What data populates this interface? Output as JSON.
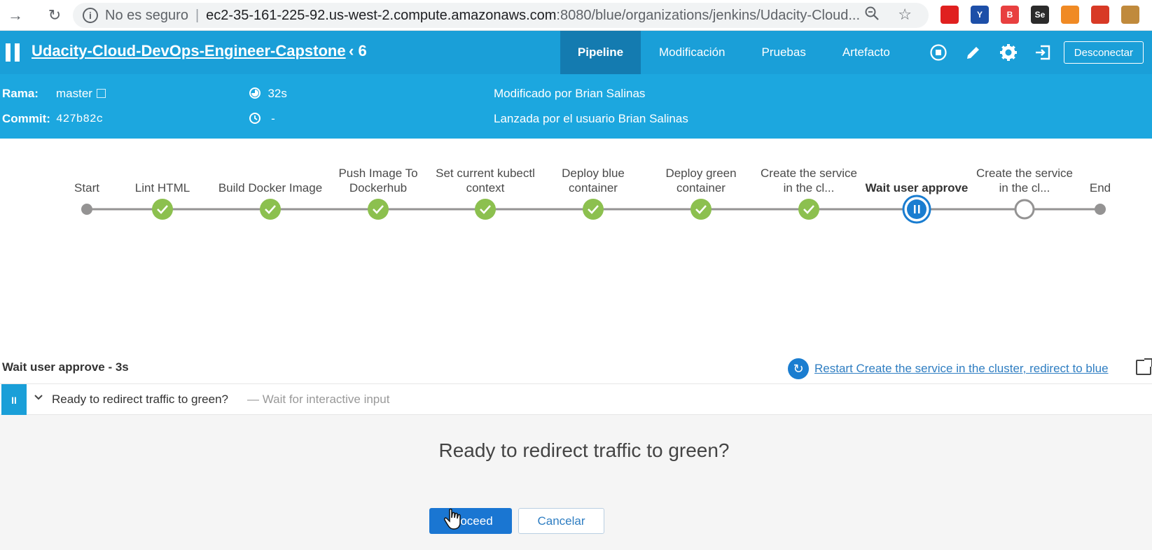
{
  "browser": {
    "security_label": "No es seguro",
    "url_host": "ec2-35-161-225-92.us-west-2.compute.amazonaws.com",
    "url_path": ":8080/blue/organizations/jenkins/Udacity-Cloud...",
    "extensions": [
      {
        "name": "ublock-icon",
        "label": "",
        "color": "#e0201f"
      },
      {
        "name": "vpn-icon",
        "label": "Y",
        "color": "#1d4fa8"
      },
      {
        "name": "extension-b-icon",
        "label": "B",
        "color": "#e84040"
      },
      {
        "name": "selenium-icon",
        "label": "Se",
        "color": "#2b2b2b"
      },
      {
        "name": "extension-figure-icon",
        "label": "",
        "color": "#f08a24"
      },
      {
        "name": "pdf-icon",
        "label": "",
        "color": "#d83a26"
      },
      {
        "name": "cookie-icon",
        "label": "",
        "color": "#c08a3c"
      }
    ]
  },
  "header": {
    "job_title": "Udacity-Cloud-DevOps-Engineer-Capstone",
    "run_number": "6",
    "tabs": [
      {
        "label": "Pipeline",
        "active": true
      },
      {
        "label": "Modificación",
        "active": false
      },
      {
        "label": "Pruebas",
        "active": false
      },
      {
        "label": "Artefacto",
        "active": false
      }
    ],
    "logout_label": "Desconectar"
  },
  "run": {
    "branch_label": "Rama:",
    "branch_value": "master",
    "commit_label": "Commit:",
    "commit_value": "427b82c",
    "duration": "32s",
    "started": "-",
    "changes": "Modificado por Brian Salinas",
    "cause": "Lanzada por el usuario Brian Salinas"
  },
  "pipeline": {
    "stages": [
      {
        "label": "Start",
        "status": "endpoint"
      },
      {
        "label": "Lint HTML",
        "status": "success"
      },
      {
        "label": "Build Docker Image",
        "status": "success"
      },
      {
        "label": "Push Image To Dockerhub",
        "status": "success"
      },
      {
        "label": "Set current kubectl context",
        "status": "success"
      },
      {
        "label": "Deploy blue container",
        "status": "success"
      },
      {
        "label": "Deploy green container",
        "status": "success"
      },
      {
        "label": "Create the service in the cl...",
        "status": "success"
      },
      {
        "label": "Wait user approve",
        "status": "paused"
      },
      {
        "label": "Create the service in the cl...",
        "status": "not_built"
      },
      {
        "label": "End",
        "status": "endpoint"
      }
    ],
    "colors": {
      "success": "#8cc04f",
      "paused": "#1a7dd0",
      "line": "#949393"
    }
  },
  "step": {
    "title": "Wait user approve - 3s",
    "restart_label": "Restart Create the service in the cluster, redirect to blue",
    "row_name": "Ready to redirect traffic to green?",
    "row_hint": "— Wait for interactive input",
    "question": "Ready to redirect traffic to green?",
    "proceed_label": "Proceed",
    "cancel_label": "Cancelar"
  }
}
